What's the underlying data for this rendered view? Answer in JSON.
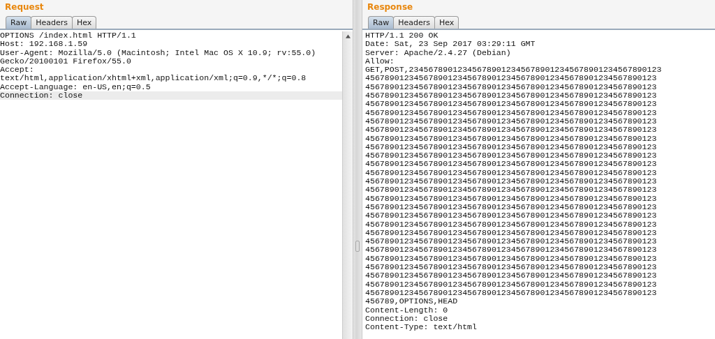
{
  "panels": [
    {
      "title": "Request",
      "tabs": [
        {
          "label": "Raw",
          "selected": true
        },
        {
          "label": "Headers",
          "selected": false
        },
        {
          "label": "Hex",
          "selected": false
        }
      ],
      "scrollbar": true,
      "lines": [
        {
          "text": "OPTIONS /index.html HTTP/1.1",
          "highlighted": false
        },
        {
          "text": "Host: 192.168.1.59",
          "highlighted": false
        },
        {
          "text": "User-Agent: Mozilla/5.0 (Macintosh; Intel Mac OS X 10.9; rv:55.0)",
          "highlighted": false
        },
        {
          "text": "Gecko/20100101 Firefox/55.0",
          "highlighted": false
        },
        {
          "text": "Accept:",
          "highlighted": false
        },
        {
          "text": "text/html,application/xhtml+xml,application/xml;q=0.9,*/*;q=0.8",
          "highlighted": false
        },
        {
          "text": "Accept-Language: en-US,en;q=0.5",
          "highlighted": false
        },
        {
          "text": "Connection: close",
          "highlighted": true
        }
      ]
    },
    {
      "title": "Response",
      "tabs": [
        {
          "label": "Raw",
          "selected": true
        },
        {
          "label": "Headers",
          "selected": false
        },
        {
          "label": "Hex",
          "selected": false
        }
      ],
      "scrollbar": false,
      "lines": [
        {
          "text": "HTTP/1.1 200 OK",
          "highlighted": false
        },
        {
          "text": "Date: Sat, 23 Sep 2017 03:29:11 GMT",
          "highlighted": false
        },
        {
          "text": "Server: Apache/2.4.27 (Debian)",
          "highlighted": false
        },
        {
          "text": "Allow:",
          "highlighted": false
        },
        {
          "text": "GET,POST,2345678901234567890123456789012345678901234567890123",
          "highlighted": false
        },
        {
          "text": "456789012345678901234567890123456789012345678901234567890123",
          "highlighted": false
        },
        {
          "text": "456789012345678901234567890123456789012345678901234567890123",
          "highlighted": false
        },
        {
          "text": "456789012345678901234567890123456789012345678901234567890123",
          "highlighted": false
        },
        {
          "text": "456789012345678901234567890123456789012345678901234567890123",
          "highlighted": false
        },
        {
          "text": "456789012345678901234567890123456789012345678901234567890123",
          "highlighted": false
        },
        {
          "text": "456789012345678901234567890123456789012345678901234567890123",
          "highlighted": false
        },
        {
          "text": "456789012345678901234567890123456789012345678901234567890123",
          "highlighted": false
        },
        {
          "text": "456789012345678901234567890123456789012345678901234567890123",
          "highlighted": false
        },
        {
          "text": "456789012345678901234567890123456789012345678901234567890123",
          "highlighted": false
        },
        {
          "text": "456789012345678901234567890123456789012345678901234567890123",
          "highlighted": false
        },
        {
          "text": "456789012345678901234567890123456789012345678901234567890123",
          "highlighted": false
        },
        {
          "text": "456789012345678901234567890123456789012345678901234567890123",
          "highlighted": false
        },
        {
          "text": "456789012345678901234567890123456789012345678901234567890123",
          "highlighted": false
        },
        {
          "text": "456789012345678901234567890123456789012345678901234567890123",
          "highlighted": false
        },
        {
          "text": "456789012345678901234567890123456789012345678901234567890123",
          "highlighted": false
        },
        {
          "text": "456789012345678901234567890123456789012345678901234567890123",
          "highlighted": false
        },
        {
          "text": "456789012345678901234567890123456789012345678901234567890123",
          "highlighted": false
        },
        {
          "text": "456789012345678901234567890123456789012345678901234567890123",
          "highlighted": false
        },
        {
          "text": "456789012345678901234567890123456789012345678901234567890123",
          "highlighted": false
        },
        {
          "text": "456789012345678901234567890123456789012345678901234567890123",
          "highlighted": false
        },
        {
          "text": "456789012345678901234567890123456789012345678901234567890123",
          "highlighted": false
        },
        {
          "text": "456789012345678901234567890123456789012345678901234567890123",
          "highlighted": false
        },
        {
          "text": "456789012345678901234567890123456789012345678901234567890123",
          "highlighted": false
        },
        {
          "text": "456789012345678901234567890123456789012345678901234567890123",
          "highlighted": false
        },
        {
          "text": "456789012345678901234567890123456789012345678901234567890123",
          "highlighted": false
        },
        {
          "text": "456789012345678901234567890123456789012345678901234567890123",
          "highlighted": false
        },
        {
          "text": "456789,OPTIONS,HEAD",
          "highlighted": false
        },
        {
          "text": "Content-Length: 0",
          "highlighted": false
        },
        {
          "text": "Connection: close",
          "highlighted": false
        },
        {
          "text": "Content-Type: text/html",
          "highlighted": false
        }
      ]
    }
  ]
}
